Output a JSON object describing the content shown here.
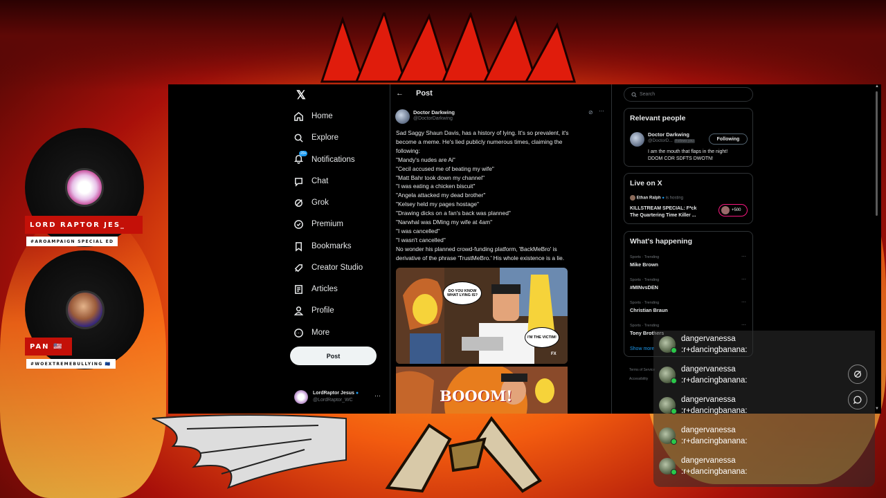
{
  "x_app": {
    "nav": [
      {
        "label": "Home",
        "icon": "home-icon"
      },
      {
        "label": "Explore",
        "icon": "search-icon"
      },
      {
        "label": "Notifications",
        "icon": "bell-icon",
        "badge": "20+"
      },
      {
        "label": "Chat",
        "icon": "chat-icon"
      },
      {
        "label": "Grok",
        "icon": "grok-icon"
      },
      {
        "label": "Premium",
        "icon": "premium-icon"
      },
      {
        "label": "Bookmarks",
        "icon": "bookmark-icon"
      },
      {
        "label": "Creator Studio",
        "icon": "rocket-icon"
      },
      {
        "label": "Articles",
        "icon": "article-icon"
      },
      {
        "label": "Profile",
        "icon": "person-icon"
      },
      {
        "label": "More",
        "icon": "more-icon"
      }
    ],
    "post_button": "Post",
    "account": {
      "name": "LordRaptor Jesus",
      "handle": "@LordRaptor_WC"
    },
    "post": {
      "header": "Post",
      "author": "Doctor Darkwing",
      "handle": "@DoctorDarkwing",
      "lines": [
        "Sad Saggy Shaun Davis, has a history of lying. It's so prevalent, it's",
        "become a meme. He's lied publicly numerous times, claiming the",
        "following:",
        "\"Mandy's nudes are Ai\"",
        "\"Cecil accused me of beating my wife\"",
        "\"Matt Bahr took down my channel\"",
        "\"I was eating a chicken biscuit\"",
        "\"Angela attacked my dead brother\"",
        "\"Kelsey held my pages hostage\"",
        "\"Drawing dicks on a fan's back was planned\"",
        "\"Narwhal was DMing my wife at 4am\"",
        "\"I was cancelled\"",
        "\"I wasn't cancelled\"",
        "No wonder his planned crowd-funding platform, 'BackMeBro' is",
        "derivative of the phrase 'TrustMeBro.' His whole existence is a lie."
      ],
      "image1": {
        "bubble1": "DO YOU KNOW WHAT LYING IS?",
        "bubble2": "I'M THE VICTIM!",
        "watermark": "FX"
      },
      "image2": {
        "text": "BOOOM!"
      }
    },
    "sidebar": {
      "search_placeholder": "Search",
      "relevant_title": "Relevant people",
      "relevant": {
        "name": "Doctor Darkwing",
        "handle": "@DoctorD...",
        "follows_you": "Follows you",
        "button": "Following",
        "bio_line1": "I am the mouth that flaps in the night!",
        "bio_line2": "DDOM COR SDFTS DWOTN!"
      },
      "live_title": "Live on X",
      "live": {
        "host": "Ethan Ralph",
        "status": "is hosting",
        "title_line1": "KILLSTREAM SPECIAL: F*ck",
        "title_line2": "The Quartering Time Killer ...",
        "count": "+500"
      },
      "happening_title": "What's happening",
      "trends": [
        {
          "category": "Sports · Trending",
          "name": "Mike Brown"
        },
        {
          "category": "Sports · Trending",
          "name": "#MINvsDEN"
        },
        {
          "category": "Sports · Trending",
          "name": "Christian Braun"
        },
        {
          "category": "Sports · Trending",
          "name": "Tony Brothers"
        }
      ],
      "show_more": "Show more",
      "footer1": "Terms of Service",
      "footer2": "Accessibility"
    }
  },
  "streamers": [
    {
      "name": "LORD RAPTOR JES_",
      "tag": "#AROAMPAIGN SPECIAL ED"
    },
    {
      "name": "PAN 🇺🇸",
      "tag": "#WOEXTREMEBULLYING 🇪🇺"
    }
  ],
  "chat": [
    {
      "user": "dangervanessa",
      "message": ":r+dancingbanana:"
    },
    {
      "user": "dangervanessa",
      "message": ":r+dancingbanana:"
    },
    {
      "user": "dangervanessa",
      "message": ":r+dancingbanana:"
    },
    {
      "user": "dangervanessa",
      "message": ":r+dancingbanana:"
    },
    {
      "user": "dangervanessa",
      "message": ":r+dancingbanana:"
    }
  ],
  "colors": {
    "x_bg": "#000000",
    "accent": "#1d9bf0",
    "name_bar": "#c41008",
    "live_badge": "#f91880"
  }
}
